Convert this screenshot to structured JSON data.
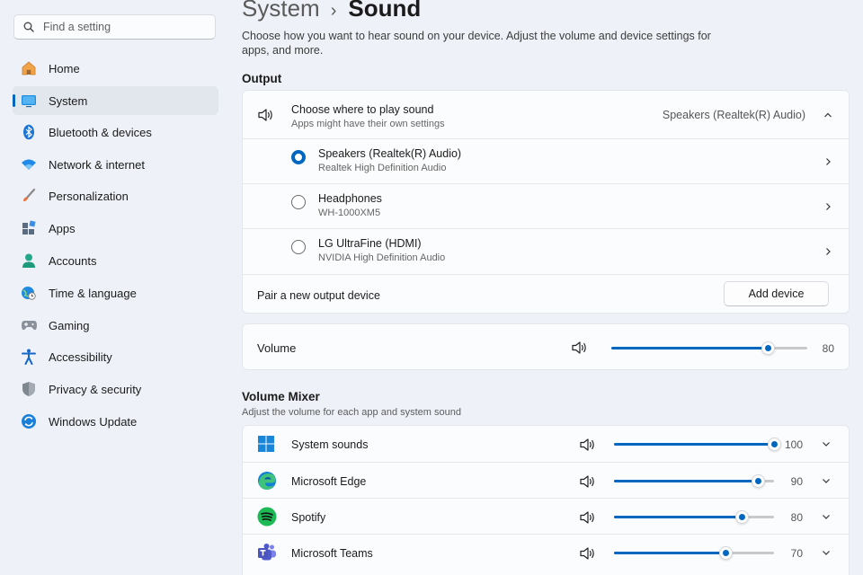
{
  "search": {
    "placeholder": "Find a setting",
    "icon": "search-icon"
  },
  "sidebar": {
    "items": [
      {
        "label": "Home",
        "icon": "home-icon",
        "active": false
      },
      {
        "label": "System",
        "icon": "system-icon",
        "active": true
      },
      {
        "label": "Bluetooth & devices",
        "icon": "bluetooth-icon",
        "active": false
      },
      {
        "label": "Network & internet",
        "icon": "wifi-icon",
        "active": false
      },
      {
        "label": "Personalization",
        "icon": "brush-icon",
        "active": false
      },
      {
        "label": "Apps",
        "icon": "apps-icon",
        "active": false
      },
      {
        "label": "Accounts",
        "icon": "accounts-icon",
        "active": false
      },
      {
        "label": "Time & language",
        "icon": "globe-clock-icon",
        "active": false
      },
      {
        "label": "Gaming",
        "icon": "gamepad-icon",
        "active": false
      },
      {
        "label": "Accessibility",
        "icon": "accessibility-icon",
        "active": false
      },
      {
        "label": "Privacy & security",
        "icon": "shield-icon",
        "active": false
      },
      {
        "label": "Windows Update",
        "icon": "update-icon",
        "active": false
      }
    ]
  },
  "header": {
    "breadcrumb_parent": "System",
    "breadcrumb_separator": "›",
    "title": "Sound",
    "description": "Choose how you want to hear sound on your device. Adjust the volume and device settings for apps, and more."
  },
  "output": {
    "section_title": "Output",
    "choose_title": "Choose where to play sound",
    "choose_sub": "Apps might have their own settings",
    "selected_device": "Speakers (Realtek(R) Audio)",
    "devices": [
      {
        "name": "Speakers (Realtek(R) Audio)",
        "detail": "Realtek High Definition Audio",
        "selected": true
      },
      {
        "name": "Headphones",
        "detail": "WH-1000XM5",
        "selected": false
      },
      {
        "name": "LG UltraFine (HDMI)",
        "detail": "NVIDIA High Definition Audio",
        "selected": false
      }
    ],
    "pair_label": "Pair a new output device",
    "add_button": "Add device"
  },
  "volume": {
    "label": "Volume",
    "value": 80
  },
  "mixer": {
    "title": "Volume Mixer",
    "subtitle": "Adjust the volume for each app and system sound",
    "apps": [
      {
        "name": "System sounds",
        "icon": "windows-icon",
        "value": 100
      },
      {
        "name": "Microsoft Edge",
        "icon": "edge-icon",
        "value": 90
      },
      {
        "name": "Spotify",
        "icon": "spotify-icon",
        "value": 80
      },
      {
        "name": "Microsoft Teams",
        "icon": "teams-icon",
        "value": 70
      }
    ]
  },
  "colors": {
    "accent": "#0067c0",
    "background": "#eef2f8",
    "card": "#fbfcfd"
  }
}
